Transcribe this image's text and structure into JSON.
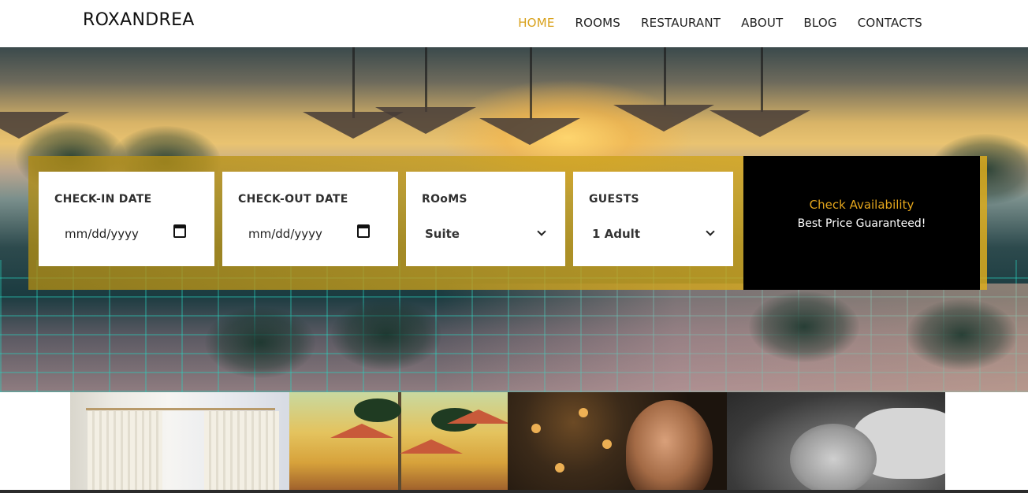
{
  "header": {
    "logo": "ROXANDREA",
    "nav": [
      "HOME",
      "ROOMS",
      "RESTAURANT",
      "ABOUT",
      "BLOG",
      "CONTACTS"
    ],
    "active_nav": "HOME"
  },
  "booking": {
    "checkin": {
      "label": "CHECK-IN DATE",
      "placeholder": "mm/dd/yyyy"
    },
    "checkout": {
      "label": "CHECK-OUT DATE",
      "placeholder": "mm/dd/yyyy"
    },
    "rooms": {
      "label": "ROoMS",
      "selected": "Suite"
    },
    "guests": {
      "label": "GUESTS",
      "selected": "1 Adult"
    },
    "cta": {
      "title": "Check Availability",
      "subtitle": "Best Price Guaranteed!"
    }
  },
  "slider": {
    "slide_count": 3,
    "active_index": 0
  },
  "thumbnails": [
    "room-photo",
    "pool-photo",
    "dining-photo",
    "spa-photo"
  ],
  "colors": {
    "accent": "#d9a11b",
    "booking_bar": "#c9a01e",
    "cta_bg": "#000000",
    "cta_text": "#e3a51c"
  }
}
